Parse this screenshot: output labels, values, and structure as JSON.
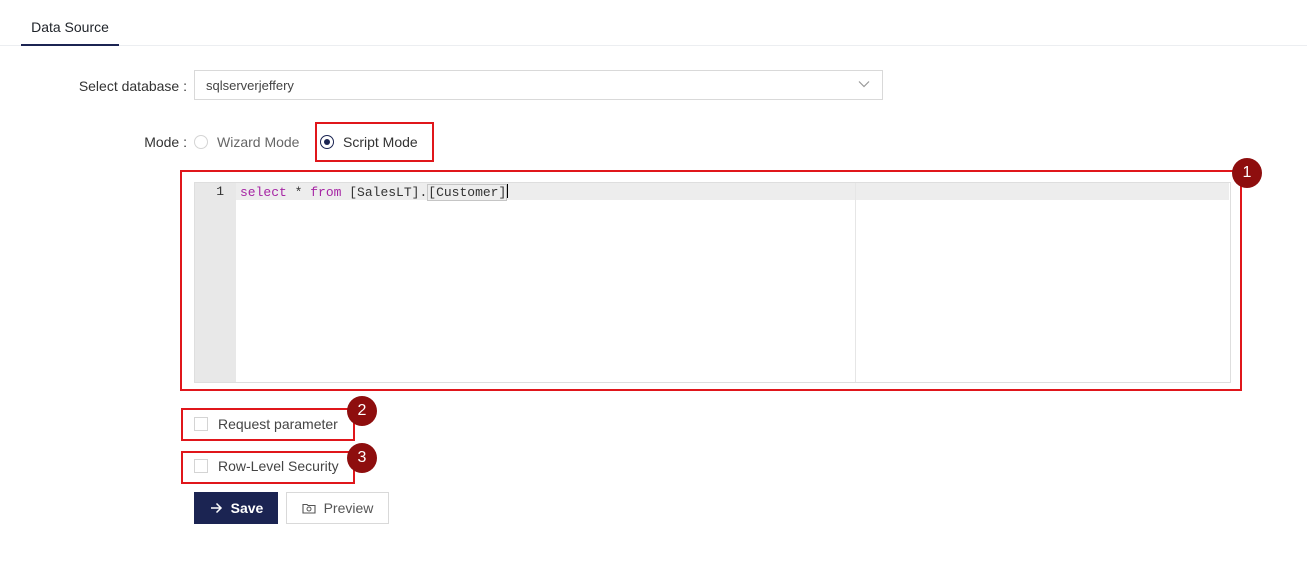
{
  "tabs": [
    {
      "label": "Data Source",
      "active": true
    }
  ],
  "form": {
    "database": {
      "label": "Select database :",
      "value": "sqlserverjeffery"
    },
    "mode": {
      "label": "Mode :",
      "options": [
        {
          "label": "Wizard Mode",
          "checked": false
        },
        {
          "label": "Script Mode",
          "checked": true
        }
      ]
    },
    "editor": {
      "line_number": "1",
      "tokens": [
        "select",
        " * ",
        "from",
        " [SalesLT].",
        "[Customer]"
      ]
    },
    "checkboxes": [
      {
        "label": "Request parameter",
        "checked": false
      },
      {
        "label": "Row-Level Security",
        "checked": false
      }
    ]
  },
  "buttons": {
    "save": "Save",
    "preview": "Preview"
  },
  "annotations": [
    "1",
    "2",
    "3"
  ],
  "colors": {
    "primary": "#1b2452",
    "highlight": "#e0161b",
    "badge": "#8e0e0e",
    "keyword": "#a626a4"
  },
  "icons": {
    "select": "chevron-down-icon",
    "save": "arrow-right-icon",
    "preview": "preview-icon"
  }
}
